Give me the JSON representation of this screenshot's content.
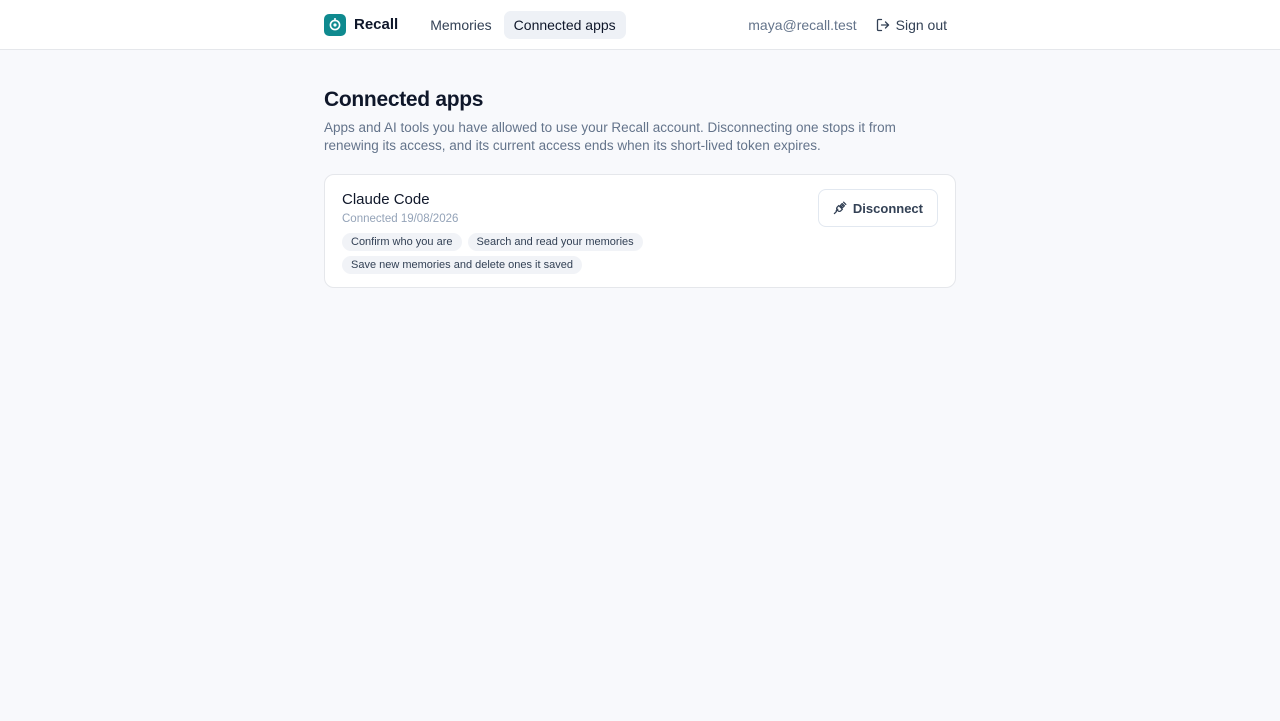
{
  "header": {
    "brand": "Recall",
    "nav": [
      {
        "label": "Memories",
        "active": false
      },
      {
        "label": "Connected apps",
        "active": true
      }
    ],
    "user_email": "maya@recall.test",
    "sign_out_label": "Sign out",
    "sign_out_icon": "sign-out-icon",
    "logo_icon": "recall-logo-icon"
  },
  "page": {
    "title": "Connected apps",
    "description": "Apps and AI tools you have allowed to use your Recall account. Disconnecting one stops it from renewing its access, and its current access ends when its short-lived token expires."
  },
  "apps": [
    {
      "name": "Claude Code",
      "connected": "Connected 19/08/2026",
      "scopes": [
        "Confirm who you are",
        "Search and read your memories",
        "Save new memories and delete ones it saved"
      ],
      "disconnect_label": "Disconnect",
      "disconnect_icon": "unplug-icon"
    }
  ],
  "colors": {
    "brand": "#0f8a8f",
    "background": "#f8f9fc",
    "surface": "#ffffff",
    "border": "#e5e7eb",
    "text": "#0f172a",
    "muted": "#64748b"
  }
}
